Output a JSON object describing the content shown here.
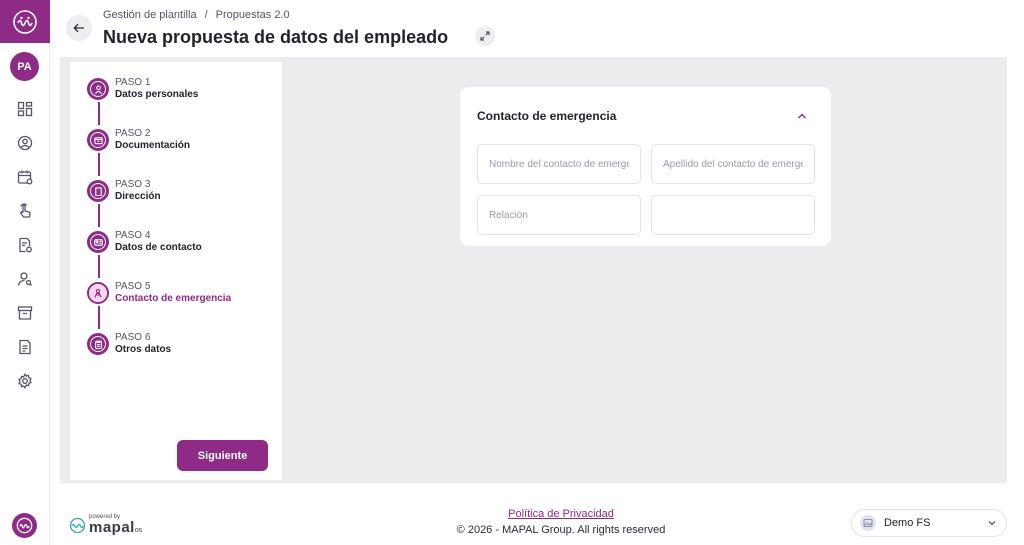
{
  "sidebar": {
    "avatar_initials": "PA",
    "items": [
      {
        "icon": "dashboard-icon"
      },
      {
        "icon": "user-circle-icon"
      },
      {
        "icon": "calendar-icon"
      },
      {
        "icon": "hand-pointer-icon"
      },
      {
        "icon": "document-clock-icon"
      },
      {
        "icon": "user-search-icon"
      },
      {
        "icon": "archive-icon"
      },
      {
        "icon": "report-icon"
      },
      {
        "icon": "gear-icon"
      }
    ]
  },
  "header": {
    "breadcrumb": [
      "Gestión de plantilla",
      "/",
      "Propuestas 2.0"
    ],
    "title": "Nueva propuesta de datos del empleado"
  },
  "steps": [
    {
      "num": "PASO 1",
      "label": "Datos personales",
      "icon": "person-icon",
      "active": false
    },
    {
      "num": "PASO 2",
      "label": "Documentación",
      "icon": "folder-icon",
      "active": false
    },
    {
      "num": "PASO 3",
      "label": "Dirección",
      "icon": "building-icon",
      "active": false
    },
    {
      "num": "PASO 4",
      "label": "Datos de contacto",
      "icon": "contact-card-icon",
      "active": false
    },
    {
      "num": "PASO 5",
      "label": "Contacto de emergencia",
      "icon": "emergency-icon",
      "active": true
    },
    {
      "num": "PASO 6",
      "label": "Otros datos",
      "icon": "clipboard-icon",
      "active": false
    }
  ],
  "next_button": "Siguiente",
  "card": {
    "title": "Contacto de emergencia",
    "fields": {
      "first_name_placeholder": "Nombre del contacto de emergencia",
      "last_name_placeholder": "Apellido del contacto de emergencia",
      "relation_placeholder": "Relación",
      "extra_placeholder": ""
    }
  },
  "footer": {
    "powered_by": "powered by",
    "brand": "mapal",
    "brand_suffix": "os",
    "privacy": "Política de Privacidad",
    "copyright": "© 2026 - MAPAL Group. All rights reserved",
    "company": "Demo FS"
  },
  "colors": {
    "brand": "#8e2b86",
    "background": "#ececee"
  }
}
